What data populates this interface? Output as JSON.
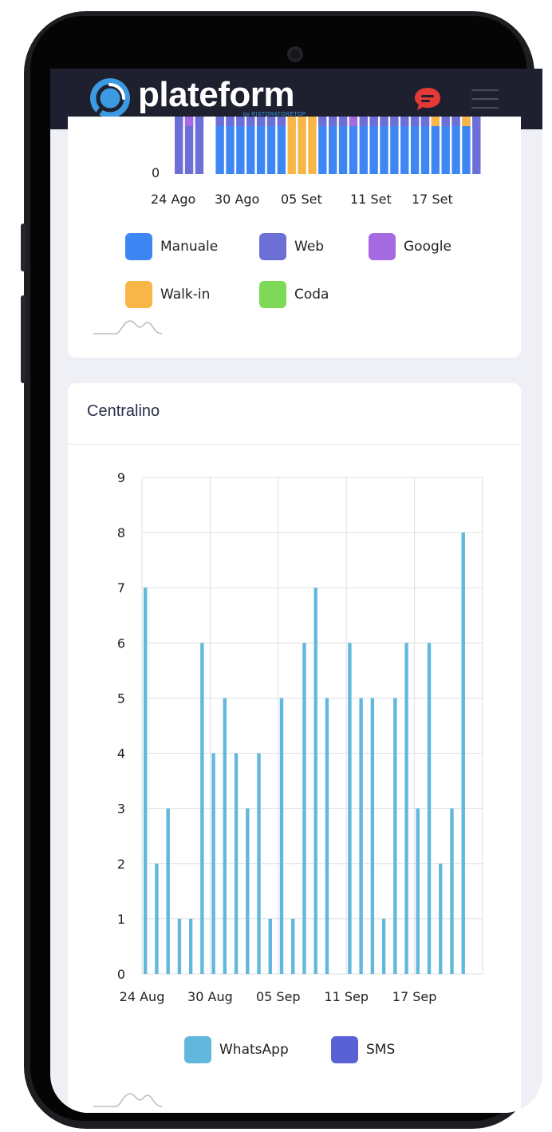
{
  "app": {
    "brand": "plateform",
    "brand_sub": "by RISTORATORETOP"
  },
  "colors": {
    "header_bg": "#1e2030",
    "chat_icon": "#e53935",
    "accent": "#3b9ae1"
  },
  "icons": [
    "logo-mark-icon",
    "chat-bubble-icon",
    "hamburger-menu-icon",
    "sparkline-icon"
  ],
  "chart_top": {
    "type": "bar",
    "stacked": true,
    "y_visible_tick": "0",
    "x_tick_labels": [
      "24 Ago",
      "30 Ago",
      "05 Set",
      "11 Set",
      "17 Set"
    ],
    "legend": [
      {
        "label": "Manuale",
        "color": "#3f86f5"
      },
      {
        "label": "Web",
        "color": "#6b6fd6"
      },
      {
        "label": "Google",
        "color": "#a56ae0"
      },
      {
        "label": "Walk-in",
        "color": "#f8b648"
      },
      {
        "label": "Coda",
        "color": "#7ed957"
      }
    ]
  },
  "centralino": {
    "title": "Centralino"
  },
  "chart_data": {
    "type": "bar",
    "title": "Centralino",
    "x_tick_labels": [
      "24 Aug",
      "30 Aug",
      "05 Sep",
      "11 Sep",
      "17 Sep"
    ],
    "y_ticks": [
      "0",
      "1",
      "2",
      "3",
      "4",
      "5",
      "6",
      "7",
      "8",
      "9"
    ],
    "ylim": [
      0,
      9
    ],
    "grid": true,
    "legend_position": "bottom",
    "categories": [
      "Aug 24",
      "Aug 25",
      "Aug 26",
      "Aug 27",
      "Aug 28",
      "Aug 29",
      "Aug 30",
      "Aug 31",
      "Sep 01",
      "Sep 02",
      "Sep 03",
      "Sep 04",
      "Sep 05",
      "Sep 06",
      "Sep 07",
      "Sep 08",
      "Sep 09",
      "Sep 10",
      "Sep 11",
      "Sep 12",
      "Sep 13",
      "Sep 14",
      "Sep 15",
      "Sep 16",
      "Sep 17",
      "Sep 18",
      "Sep 19",
      "Sep 20",
      "Sep 21",
      "Sep 22"
    ],
    "series": [
      {
        "name": "WhatsApp",
        "color": "#62b8dc",
        "values": [
          7,
          2,
          3,
          1,
          1,
          6,
          4,
          5,
          4,
          3,
          4,
          1,
          5,
          1,
          6,
          7,
          5,
          0,
          6,
          5,
          5,
          1,
          5,
          6,
          3,
          6,
          2,
          3,
          8,
          0
        ]
      },
      {
        "name": "SMS",
        "color": "#5a61d6",
        "values": [
          0,
          0,
          0,
          0,
          0,
          0,
          0,
          0,
          0,
          0,
          0,
          0,
          0,
          0,
          0,
          0,
          0,
          0,
          0,
          0,
          0,
          0,
          0,
          0,
          0,
          0,
          0,
          0,
          0,
          0
        ]
      }
    ]
  }
}
